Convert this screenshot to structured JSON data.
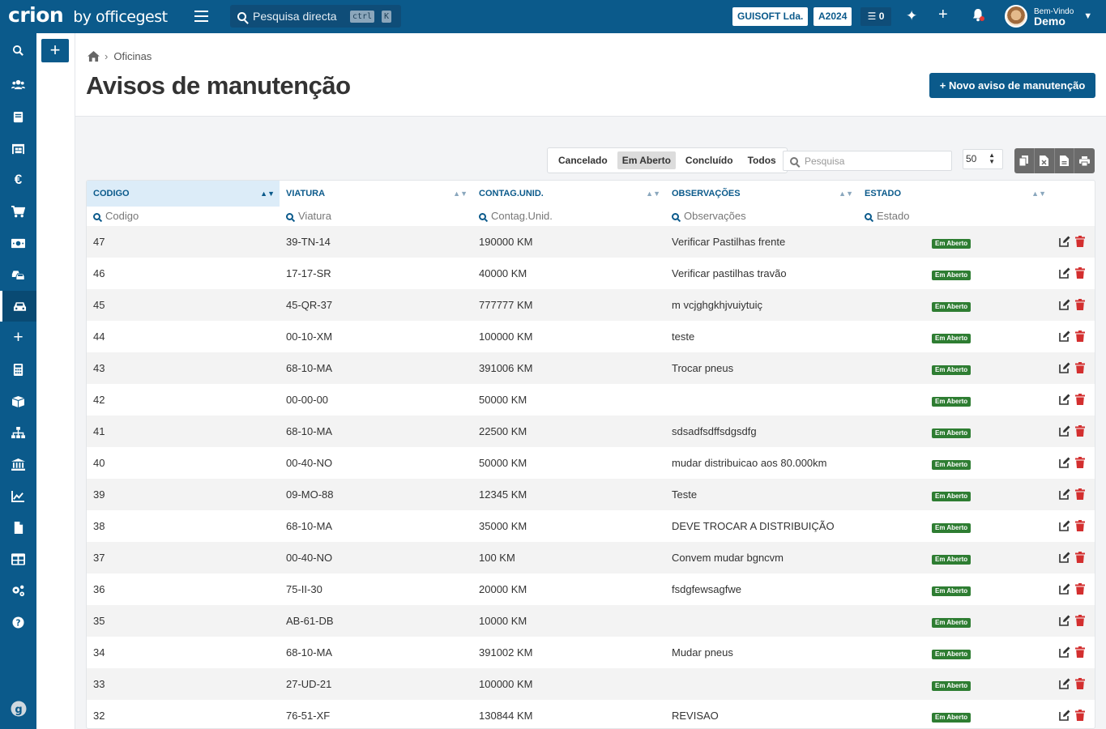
{
  "topbar": {
    "logo_main": "crion",
    "logo_sub": "by officegest",
    "search_placeholder": "Pesquisa directa",
    "kbd_ctrl": "ctrl",
    "kbd_k": "K",
    "company": "GUISOFT Lda.",
    "year": "A2024",
    "tasks_count": "0",
    "greeting": "Bem-Vindo",
    "username": "Demo"
  },
  "sidebar": {
    "icons": [
      "search-icon",
      "users-icon",
      "book-icon",
      "warehouse-icon",
      "euro-icon",
      "cart-icon",
      "money-icon",
      "cars-icon",
      "car-icon",
      "plus-icon",
      "calculator-icon",
      "boxes-icon",
      "sitemap-icon",
      "bank-icon",
      "chart-icon",
      "file-icon",
      "table-icon",
      "cogs-icon",
      "help-icon",
      "g-logo-icon"
    ],
    "active_index": 8
  },
  "breadcrumb": {
    "section": "Oficinas"
  },
  "page": {
    "title": "Avisos de manutenção",
    "new_button": "+ Novo aviso de manutenção"
  },
  "filters": {
    "items": [
      "Cancelado",
      "Em Aberto",
      "Concluído",
      "Todos"
    ],
    "active": "Em Aberto"
  },
  "toolbar": {
    "search_placeholder": "Pesquisa",
    "page_size": "50"
  },
  "table": {
    "columns": [
      "CODIGO",
      "VIATURA",
      "CONTAG.UNID.",
      "OBSERVAÇÕES",
      "ESTADO"
    ],
    "filter_placeholders": [
      "Codigo",
      "Viatura",
      "Contag.Unid.",
      "Observações",
      "Estado"
    ],
    "rows": [
      {
        "codigo": "47",
        "viatura": "39-TN-14",
        "contag": "190000 KM",
        "obs": "Verificar Pastilhas frente",
        "estado": "Em Aberto"
      },
      {
        "codigo": "46",
        "viatura": "17-17-SR",
        "contag": "40000 KM",
        "obs": "Verificar pastilhas travão",
        "estado": "Em Aberto"
      },
      {
        "codigo": "45",
        "viatura": "45-QR-37",
        "contag": "777777 KM",
        "obs": "m vcjghgkhjvuiytuiç",
        "estado": "Em Aberto"
      },
      {
        "codigo": "44",
        "viatura": "00-10-XM",
        "contag": "100000 KM",
        "obs": "teste",
        "estado": "Em Aberto"
      },
      {
        "codigo": "43",
        "viatura": "68-10-MA",
        "contag": "391006 KM",
        "obs": "Trocar pneus",
        "estado": "Em Aberto"
      },
      {
        "codigo": "42",
        "viatura": "00-00-00",
        "contag": "50000 KM",
        "obs": "",
        "estado": "Em Aberto"
      },
      {
        "codigo": "41",
        "viatura": "68-10-MA",
        "contag": "22500 KM",
        "obs": "sdsadfsdffsdgsdfg",
        "estado": "Em Aberto"
      },
      {
        "codigo": "40",
        "viatura": "00-40-NO",
        "contag": "50000 KM",
        "obs": "mudar distribuicao aos 80.000km",
        "estado": "Em Aberto"
      },
      {
        "codigo": "39",
        "viatura": "09-MO-88",
        "contag": "12345 KM",
        "obs": "Teste",
        "estado": "Em Aberto"
      },
      {
        "codigo": "38",
        "viatura": "68-10-MA",
        "contag": "35000 KM",
        "obs": "DEVE TROCAR A DISTRIBUIÇÃO",
        "estado": "Em Aberto"
      },
      {
        "codigo": "37",
        "viatura": "00-40-NO",
        "contag": "100 KM",
        "obs": "Convem mudar bgncvm",
        "estado": "Em Aberto"
      },
      {
        "codigo": "36",
        "viatura": "75-II-30",
        "contag": "20000 KM",
        "obs": "fsdgfewsagfwe",
        "estado": "Em Aberto"
      },
      {
        "codigo": "35",
        "viatura": "AB-61-DB",
        "contag": "10000 KM",
        "obs": "",
        "estado": "Em Aberto"
      },
      {
        "codigo": "34",
        "viatura": "68-10-MA",
        "contag": "391002 KM",
        "obs": "Mudar pneus",
        "estado": "Em Aberto"
      },
      {
        "codigo": "33",
        "viatura": "27-UD-21",
        "contag": "100000 KM",
        "obs": "",
        "estado": "Em Aberto"
      },
      {
        "codigo": "32",
        "viatura": "76-51-XF",
        "contag": "130844 KM",
        "obs": "REVISAO",
        "estado": "Em Aberto"
      }
    ]
  },
  "colors": {
    "brand": "#0b5a8b",
    "status_open": "#2e7d32",
    "delete": "#d32f2f"
  }
}
